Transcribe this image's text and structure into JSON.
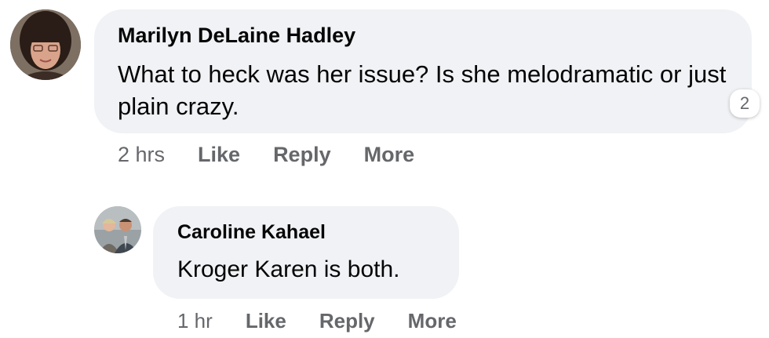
{
  "comments": [
    {
      "author": "Marilyn DeLaine Hadley",
      "text": "What to heck was her issue? Is she melodramatic or just plain crazy.",
      "reaction_count": "2",
      "time": "2 hrs",
      "actions": [
        "Like",
        "Reply",
        "More"
      ]
    }
  ],
  "replies": [
    {
      "author": "Caroline Kahael",
      "text": "Kroger Karen is both.",
      "time": "1 hr",
      "actions": [
        "Like",
        "Reply",
        "More"
      ]
    }
  ],
  "colors": {
    "bubble": "#f0f2f5",
    "text": "#050505",
    "secondary": "#65676b"
  }
}
